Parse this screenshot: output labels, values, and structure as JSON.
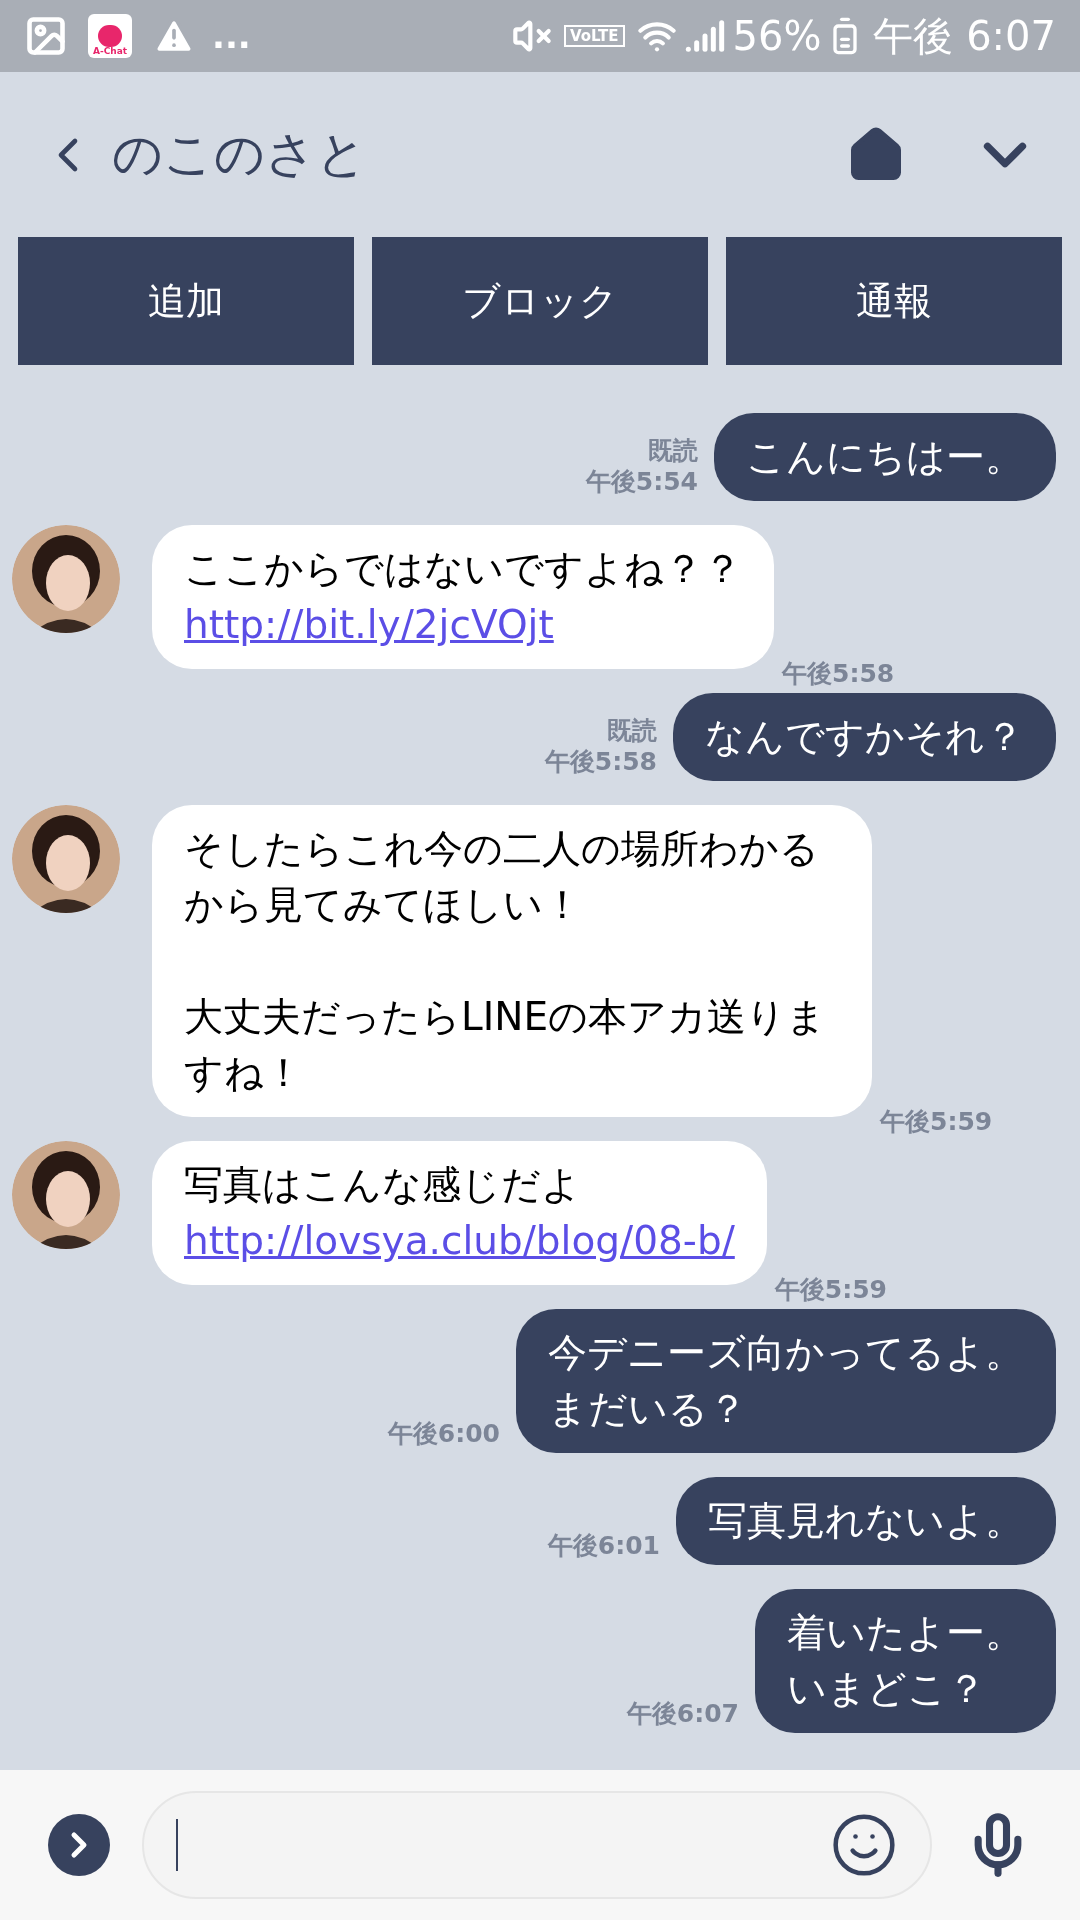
{
  "status_bar": {
    "app_label": "A-Chat",
    "more": "...",
    "network_badge": "VoLTE",
    "battery": "56%",
    "time": "午後 6:07"
  },
  "header": {
    "title": "のこのさと"
  },
  "actions": [
    {
      "label": "追加"
    },
    {
      "label": "ブロック"
    },
    {
      "label": "通報"
    }
  ],
  "messages": [
    {
      "kind": "sent",
      "lines": [
        "こんにちはー。"
      ],
      "read": "既読",
      "time": "午後5:54"
    },
    {
      "kind": "received",
      "lines": [
        "ここからではないですよね？？"
      ],
      "link": "http://bit.ly/2jcVOjt",
      "time": "午後5:58"
    },
    {
      "kind": "sent",
      "lines": [
        "なんですかそれ？"
      ],
      "read": "既読",
      "time": "午後5:58"
    },
    {
      "kind": "received",
      "lines": [
        "そしたらこれ今の二人の場所わかるから見てみてほしい！",
        "大丈夫だったらLINEの本アカ送りますね！"
      ],
      "time": "午後5:59"
    },
    {
      "kind": "received",
      "lines": [
        "写真はこんな感じだよ"
      ],
      "link": "http://lovsya.club/blog/08-b/",
      "time": "午後5:59"
    },
    {
      "kind": "sent",
      "lines": [
        "今デニーズ向かってるよ。",
        "まだいる？"
      ],
      "time": "午後6:00"
    },
    {
      "kind": "sent",
      "lines": [
        "写真見れないよ。"
      ],
      "time": "午後6:01"
    },
    {
      "kind": "sent",
      "lines": [
        "着いたよー。",
        "いまどこ？"
      ],
      "time": "午後6:07"
    }
  ]
}
